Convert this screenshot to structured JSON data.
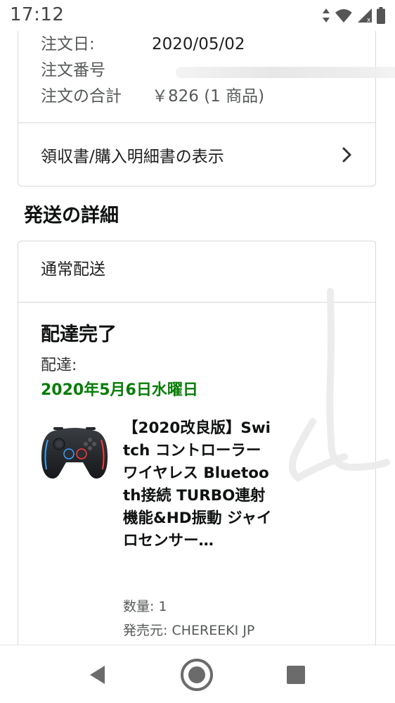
{
  "status_bar": {
    "time": "17:12",
    "network_badge": "4"
  },
  "order_summary": {
    "rows": [
      {
        "label": "注文日:",
        "value": "2020/05/02"
      },
      {
        "label": "注文番号",
        "value": ""
      },
      {
        "label": "注文の合計",
        "value": "￥826 (1 商品)"
      }
    ],
    "receipt_link": "領収書/購入明細書の表示"
  },
  "shipping_section": {
    "title": "発送の詳細",
    "method": "通常配送",
    "status": "配達完了",
    "delivery_label": "配達:",
    "delivery_date": "2020年5月6日水曜日",
    "date_color": "#067d06"
  },
  "product": {
    "title": "【2020改良版】Switch コントローラー ワイヤレス Bluetooth接続 TURBO連射機能&HD振動 ジャイロセンサー…",
    "quantity": "数量: 1",
    "seller": "発売元: CHEREEKI JP",
    "image_icon": "game-controller-icon"
  },
  "nav_bar": {
    "back_icon": "triangle-back-icon",
    "home_icon": "circle-home-icon",
    "recent_icon": "square-recent-icon"
  }
}
